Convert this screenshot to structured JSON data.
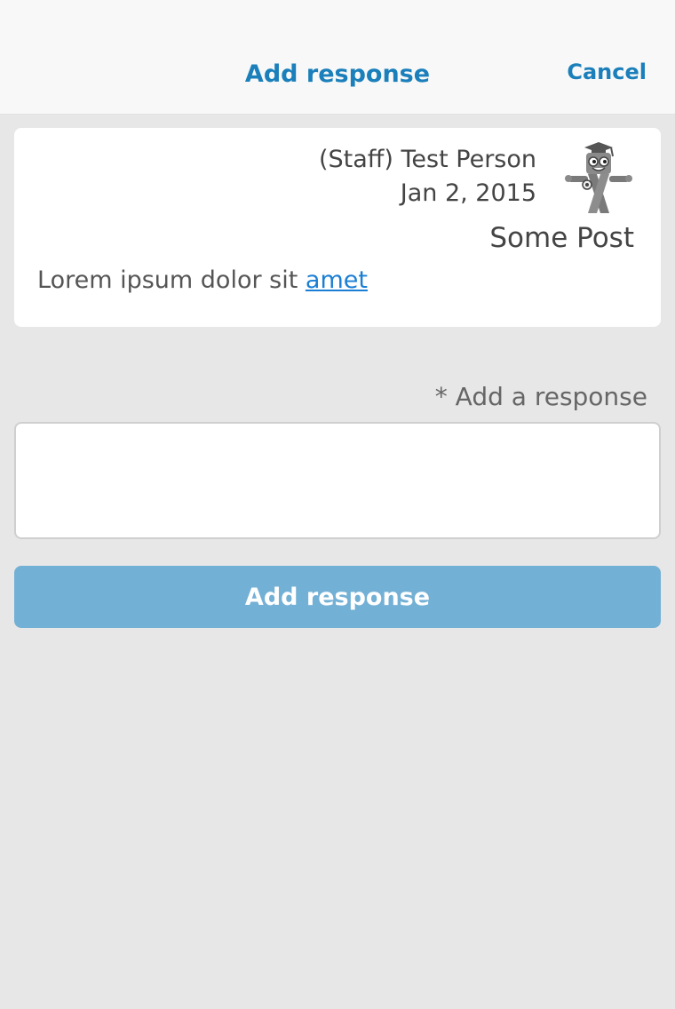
{
  "nav": {
    "title": "Add response",
    "cancel_label": "Cancel"
  },
  "post": {
    "author": "(Staff) Test Person",
    "date": "Jan 2, 2015",
    "title": "Some Post",
    "body_text": "Lorem ipsum dolor sit ",
    "body_link": "amet",
    "avatar_icon": "mascot-graduate-icon"
  },
  "form": {
    "label": "* Add a response",
    "response_value": "",
    "submit_label": "Add response"
  },
  "colors": {
    "accent": "#1a7fba",
    "button": "#73b0d5",
    "background": "#e7e7e7"
  }
}
